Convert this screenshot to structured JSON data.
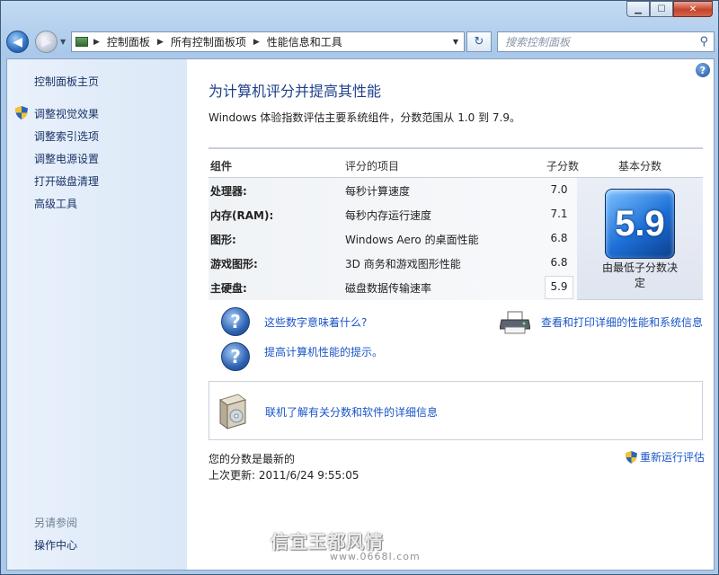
{
  "window": {
    "minimize_glyph": "▁",
    "maximize_glyph": "☐",
    "close_glyph": "✕"
  },
  "navbar": {
    "back_glyph": "◀",
    "forward_glyph": "▶",
    "history_glyph": "▼",
    "breadcrumb": [
      "控制面板",
      "所有控制面板项",
      "性能信息和工具"
    ],
    "separator": "▶",
    "dropdown_glyph": "▼",
    "refresh_glyph": "↻",
    "search_placeholder": "搜索控制面板",
    "search_glyph": "⚲"
  },
  "sidebar": {
    "home": "控制面板主页",
    "items": [
      "调整视觉效果",
      "调整索引选项",
      "调整电源设置",
      "打开磁盘清理",
      "高级工具"
    ],
    "see_also_title": "另请参阅",
    "see_also_items": [
      "操作中心"
    ]
  },
  "main": {
    "help_glyph": "?",
    "title": "为计算机评分并提高其性能",
    "description": "Windows 体验指数评估主要系统组件，分数范围从 1.0 到 7.9。",
    "table": {
      "headers": {
        "component": "组件",
        "item": "评分的项目",
        "subscore": "子分数",
        "base": "基本分数"
      },
      "rows": [
        {
          "component": "处理器:",
          "item": "每秒计算速度",
          "score": "7.0"
        },
        {
          "component": "内存(RAM):",
          "item": "每秒内存运行速度",
          "score": "7.1"
        },
        {
          "component": "图形:",
          "item": "Windows Aero 的桌面性能",
          "score": "6.8"
        },
        {
          "component": "游戏图形:",
          "item": "3D 商务和游戏图形性能",
          "score": "6.8"
        },
        {
          "component": "主硬盘:",
          "item": "磁盘数据传输速率",
          "score": "5.9"
        }
      ],
      "base_score": "5.9",
      "base_caption_line1": "由最低子分数决",
      "base_caption_line2": "定"
    },
    "links": {
      "what_numbers_mean": "这些数字意味着什么?",
      "tips": "提高计算机性能的提示。",
      "view_print": "查看和打印详细的性能和系统信息",
      "online_info": "联机了解有关分数和软件的详细信息",
      "rerun": "重新运行评估"
    },
    "question_glyph": "?",
    "status_current": "您的分数是最新的",
    "last_update": "上次更新: 2011/6/24 9:55:05"
  },
  "watermark": {
    "text": "信宜玉都风情",
    "url": "www.0668I.com"
  }
}
